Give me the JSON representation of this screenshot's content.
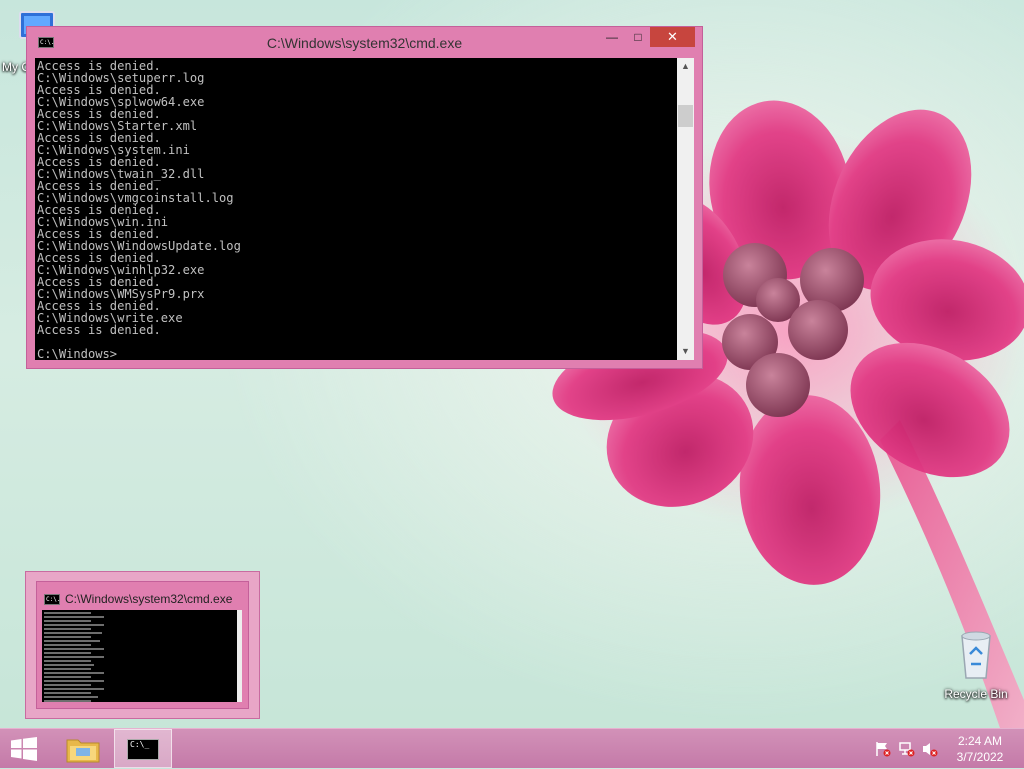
{
  "desktop": {
    "icons": {
      "my_computer": "My C",
      "recycle_bin": "Recycle Bin"
    }
  },
  "cmd_window": {
    "title": "C:\\Windows\\system32\\cmd.exe",
    "icon_text": "C:\\.",
    "buttons": {
      "minimize": "—",
      "maximize": "□",
      "close": "✕"
    },
    "scroll_up": "▲",
    "scroll_down": "▼",
    "lines": [
      "Access is denied.",
      "C:\\Windows\\setuperr.log",
      "Access is denied.",
      "C:\\Windows\\splwow64.exe",
      "Access is denied.",
      "C:\\Windows\\Starter.xml",
      "Access is denied.",
      "C:\\Windows\\system.ini",
      "Access is denied.",
      "C:\\Windows\\twain_32.dll",
      "Access is denied.",
      "C:\\Windows\\vmgcoinstall.log",
      "Access is denied.",
      "C:\\Windows\\win.ini",
      "Access is denied.",
      "C:\\Windows\\WindowsUpdate.log",
      "Access is denied.",
      "C:\\Windows\\winhlp32.exe",
      "Access is denied.",
      "C:\\Windows\\WMSysPr9.prx",
      "Access is denied.",
      "C:\\Windows\\write.exe",
      "Access is denied.",
      "",
      "C:\\Windows>"
    ]
  },
  "thumbnail": {
    "title": "C:\\Windows\\system32\\cmd.exe",
    "icon_text": "C:\\."
  },
  "taskbar": {
    "cmd_icon_text": "C:\\_",
    "clock": {
      "time": "2:24 AM",
      "date": "3/7/2022"
    }
  }
}
